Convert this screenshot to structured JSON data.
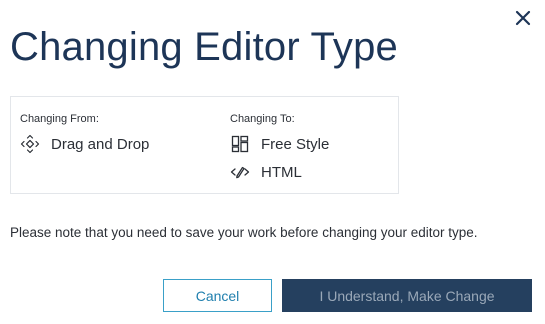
{
  "dialog": {
    "title": "Changing Editor Type",
    "close_icon": "close-icon"
  },
  "changing_from": {
    "label": "Changing From:",
    "options": [
      {
        "label": "Drag and Drop",
        "icon": "drag-and-drop-icon"
      }
    ]
  },
  "changing_to": {
    "label": "Changing To:",
    "options": [
      {
        "label": "Free Style",
        "icon": "free-style-layout-icon"
      },
      {
        "label": "HTML",
        "icon": "html-code-pen-icon"
      }
    ]
  },
  "note": "Please note that you need to save your work before changing your editor type.",
  "buttons": {
    "cancel_label": "Cancel",
    "confirm_label": "I Understand, Make Change"
  },
  "colors": {
    "title": "#1d3557",
    "primary_button": "#25405f",
    "cancel_border": "#3aa0c8"
  }
}
